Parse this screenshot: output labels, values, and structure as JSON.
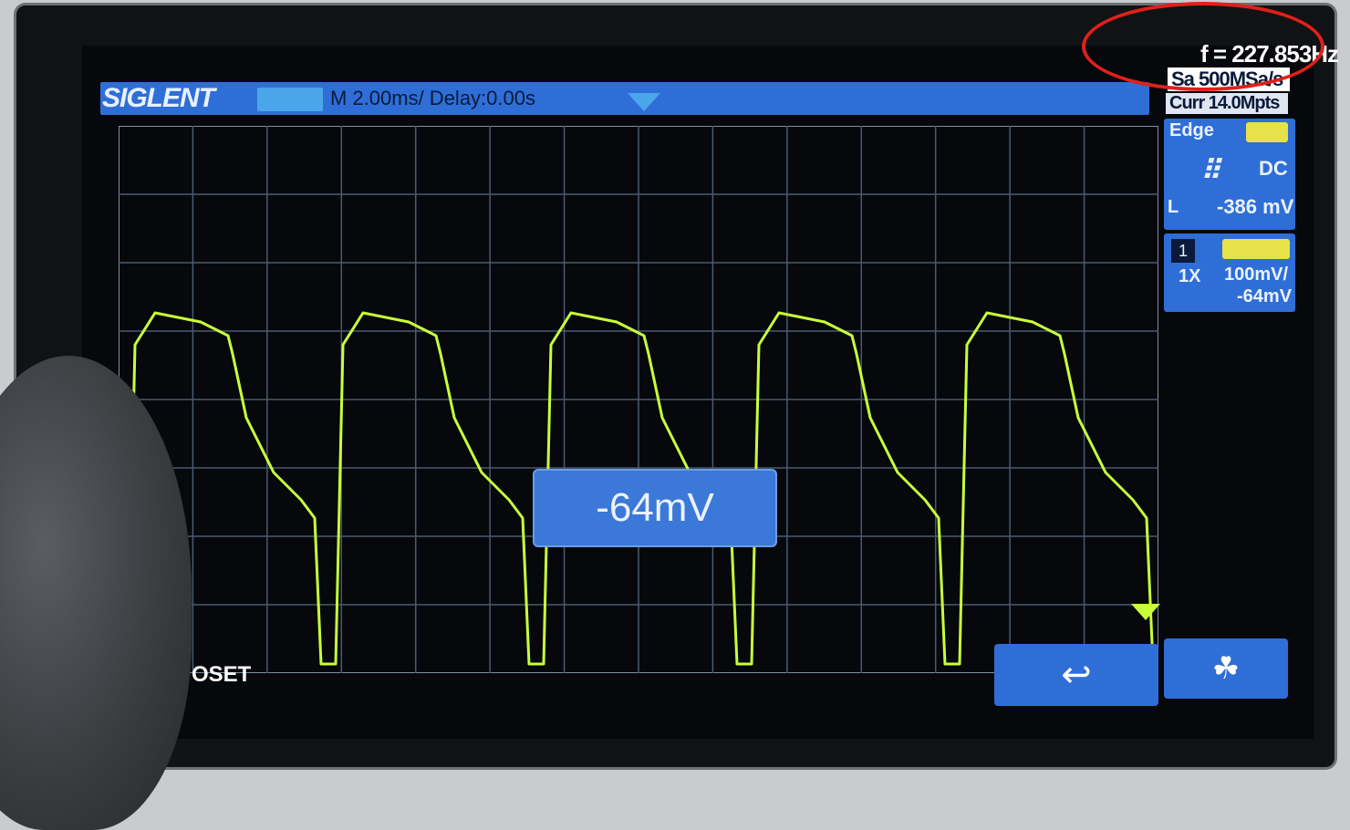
{
  "header": {
    "brand": "SIGLENT",
    "timebase": "M 2.00ms/ Delay:0.00s"
  },
  "side_panel": {
    "frequency": "f = 227.853Hz",
    "sample_rate": "Sa 500MSa/s",
    "curr": "Curr 14.0Mpts",
    "trigger": {
      "type": "Edge",
      "slope_icon": "rising-edge-icon",
      "coupling": "DC",
      "level_label": "L",
      "level": "-386 mV"
    },
    "channel": {
      "number": "1",
      "probe": "1X",
      "scale": "100mV/",
      "offset": "-64mV"
    }
  },
  "popup": {
    "offset_value": "-64mV"
  },
  "softkeys": {
    "offset_label": "OSET",
    "back_icon": "return-arrow-icon",
    "tree_icon": "tree-icon"
  },
  "colors": {
    "trace": "#c9ff3a",
    "menu_blue": "#2f6ed6",
    "annotation_red": "#e0201a"
  },
  "waveform": {
    "description": "repeating sawtooth-like pulse train, channel 1",
    "cycles": 5
  }
}
